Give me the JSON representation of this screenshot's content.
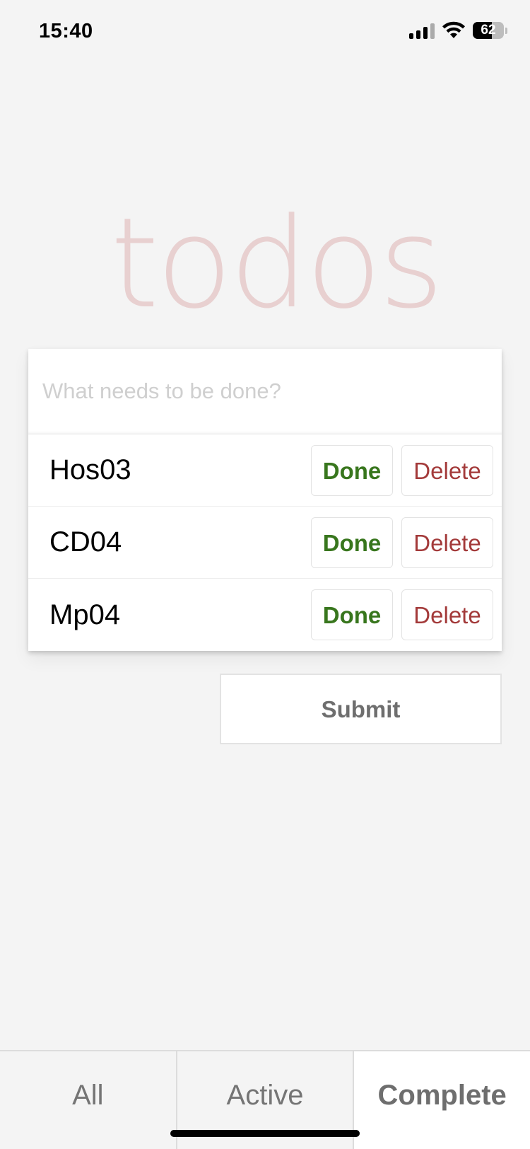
{
  "status_bar": {
    "time": "15:40",
    "battery": "62",
    "icons": [
      "signal-icon",
      "wifi-icon",
      "battery-icon"
    ]
  },
  "app": {
    "title": "todos"
  },
  "new_todo": {
    "placeholder": "What needs to be done?",
    "value": ""
  },
  "todos": [
    {
      "label": "Hos03",
      "done_label": "Done",
      "delete_label": "Delete"
    },
    {
      "label": "CD04",
      "done_label": "Done",
      "delete_label": "Delete"
    },
    {
      "label": "Mp04",
      "done_label": "Done",
      "delete_label": "Delete"
    }
  ],
  "submit_label": "Submit",
  "filters": {
    "tabs": [
      {
        "label": "All",
        "active": false
      },
      {
        "label": "Active",
        "active": false
      },
      {
        "label": "Complete",
        "active": true
      }
    ]
  },
  "colors": {
    "background": "#f4f4f4",
    "title": "#e6cfcf",
    "done": "#38761d",
    "delete": "#a33a3a",
    "placeholder": "#cfcfcf"
  }
}
